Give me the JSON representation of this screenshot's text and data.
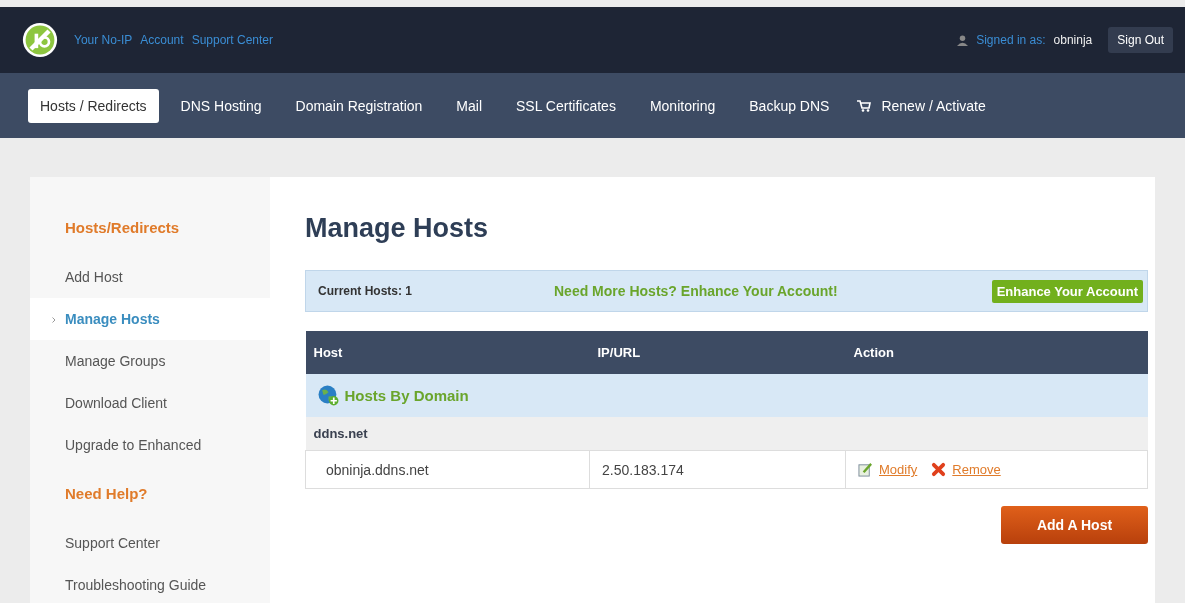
{
  "topbar": {
    "links": [
      "Your No-IP",
      "Account",
      "Support Center"
    ],
    "signed_in_label": "Signed in as:",
    "username": "obninja",
    "sign_out": "Sign Out"
  },
  "nav": [
    {
      "label": "Hosts / Redirects",
      "selected": true,
      "kind": "plain"
    },
    {
      "label": "DNS Hosting",
      "selected": false,
      "kind": "plain"
    },
    {
      "label": "Domain Registration",
      "selected": false,
      "kind": "plain"
    },
    {
      "label": "Mail",
      "selected": false,
      "kind": "plain"
    },
    {
      "label": "SSL Certificates",
      "selected": false,
      "kind": "plain"
    },
    {
      "label": "Monitoring",
      "selected": false,
      "kind": "plain"
    },
    {
      "label": "Backup DNS",
      "selected": false,
      "kind": "plain"
    },
    {
      "label": "Renew / Activate",
      "selected": false,
      "kind": "cart"
    }
  ],
  "sidebar": [
    {
      "heading": "Hosts/Redirects",
      "items": [
        {
          "label": "Add Host",
          "selected": false
        },
        {
          "label": "Manage Hosts",
          "selected": true
        },
        {
          "label": "Manage Groups",
          "selected": false
        },
        {
          "label": "Download Client",
          "selected": false
        },
        {
          "label": "Upgrade to Enhanced",
          "selected": false
        }
      ]
    },
    {
      "heading": "Need Help?",
      "items": [
        {
          "label": "Support Center",
          "selected": false
        },
        {
          "label": "Troubleshooting Guide",
          "selected": false
        }
      ]
    }
  ],
  "main": {
    "title": "Manage Hosts",
    "banner": {
      "label": "Current Hosts:",
      "count": "1",
      "promo": "Need More Hosts? Enhance Your Account!",
      "button": "Enhance Your Account"
    },
    "table": {
      "columns": [
        "Host",
        "IP/URL",
        "Action"
      ],
      "group": "Hosts By Domain",
      "domain": "ddns.net",
      "rows": [
        {
          "host": "obninja.ddns.net",
          "ip": "2.50.183.174",
          "modify": "Modify",
          "remove": "Remove"
        }
      ]
    },
    "add_button": "Add A Host"
  }
}
